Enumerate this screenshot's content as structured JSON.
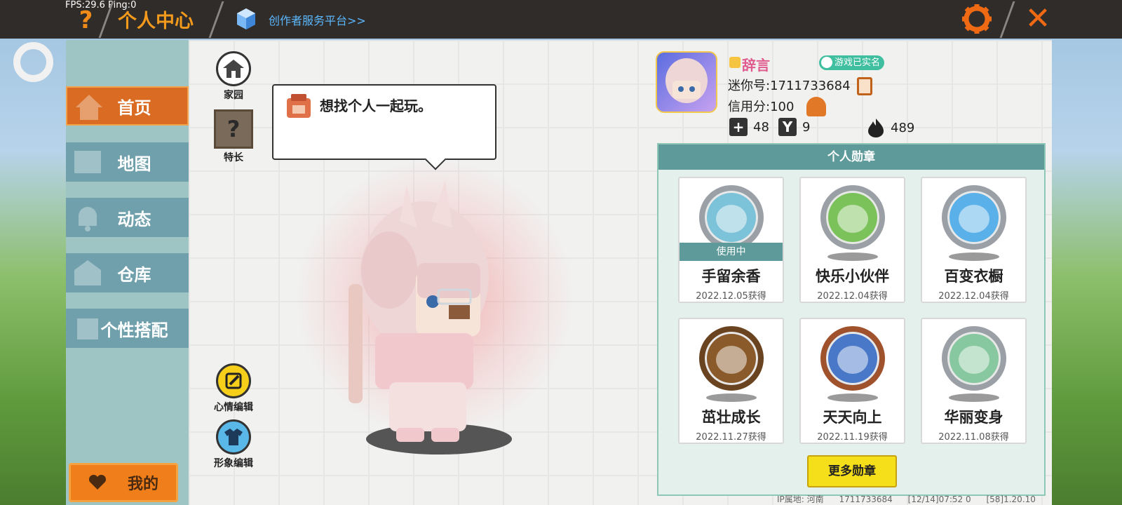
{
  "topbar": {
    "fps": "FPS:29.6  Ping:0",
    "help_symbol": "?",
    "title": "个人中心",
    "creator_link": "创作者服务平台>>",
    "close_symbol": "✕"
  },
  "sidebar": {
    "items": [
      {
        "label": "首页",
        "icon": "home-icon",
        "active": true
      },
      {
        "label": "地图",
        "icon": "map-icon",
        "active": false
      },
      {
        "label": "动态",
        "icon": "bell-icon",
        "active": false
      },
      {
        "label": "仓库",
        "icon": "warehouse-icon",
        "active": false
      },
      {
        "label": "个性搭配",
        "icon": "outfit-icon",
        "active": false
      }
    ],
    "mine_label": "我的"
  },
  "main": {
    "home_label": "家园",
    "skill_label": "特长",
    "skill_symbol": "?",
    "mood_label": "心情编辑",
    "look_label": "形象编辑",
    "bubble_text": "想找个人一起玩。"
  },
  "profile": {
    "nickname": "辞言",
    "verified": "游戏已实名",
    "mini_id": "迷你号:1711733684",
    "credit": "信用分:100",
    "stats": [
      {
        "icon": "plus-icon",
        "value": "48"
      },
      {
        "icon": "cheer-icon",
        "value": "9"
      },
      {
        "icon": "fire-icon",
        "value": "489"
      }
    ]
  },
  "badges": {
    "title": "个人勋章",
    "in_use_label": "使用中",
    "items": [
      {
        "name": "手留余香",
        "date": "2022.12.05获得",
        "in_use": true,
        "color": "#7cc2d8"
      },
      {
        "name": "快乐小伙伴",
        "date": "2022.12.04获得",
        "in_use": false,
        "color": "#7cc25a"
      },
      {
        "name": "百变衣橱",
        "date": "2022.12.04获得",
        "in_use": false,
        "color": "#5ab0e8"
      },
      {
        "name": "茁壮成长",
        "date": "2022.11.27获得",
        "in_use": false,
        "color": "#8a5a2a"
      },
      {
        "name": "天天向上",
        "date": "2022.11.19获得",
        "in_use": false,
        "color": "#4a78c8"
      },
      {
        "name": "华丽变身",
        "date": "2022.11.08获得",
        "in_use": false,
        "color": "#88c8a0"
      }
    ],
    "more_label": "更多勋章"
  },
  "footer": {
    "ip": "IP属地: 河南",
    "uid": "1711733684",
    "time": "[12/14]07:52 0",
    "version": "[58]1.20.10"
  },
  "colors": {
    "accent": "#f39a1c",
    "sidebar_active": "#d96b22",
    "teal": "#5e9a9a",
    "link": "#5cb8ff"
  }
}
